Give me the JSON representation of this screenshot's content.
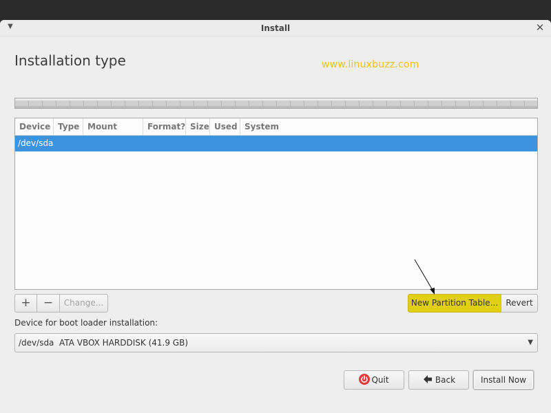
{
  "window": {
    "title": "Install"
  },
  "page": {
    "title": "Installation type",
    "watermark": "www.linuxbuzz.com"
  },
  "table": {
    "columns": [
      "Device",
      "Type",
      "Mount point",
      "Format?",
      "Size",
      "Used",
      "System"
    ],
    "rows": [
      {
        "device": "/dev/sda",
        "selected": true
      }
    ]
  },
  "toolbar": {
    "add_label": "+",
    "remove_label": "−",
    "change_label": "Change..."
  },
  "actions": {
    "new_partition_table_label": "New Partition Table...",
    "revert_label": "Revert"
  },
  "bootloader": {
    "label": "Device for boot loader installation:",
    "selected": "/dev/sda  ATA VBOX HARDDISK (41.9 GB)"
  },
  "buttons": {
    "quit": "Quit",
    "back": "Back",
    "install": "Install Now"
  },
  "colors": {
    "selection": "#3c93e0",
    "highlight": "#e1cf16",
    "watermark": "#f0c400",
    "quit_icon": "#e03a3a"
  },
  "icons": {
    "window_menu": "chevron-down-icon",
    "close": "close-icon",
    "quit": "power-icon",
    "back": "arrow-left-icon"
  }
}
